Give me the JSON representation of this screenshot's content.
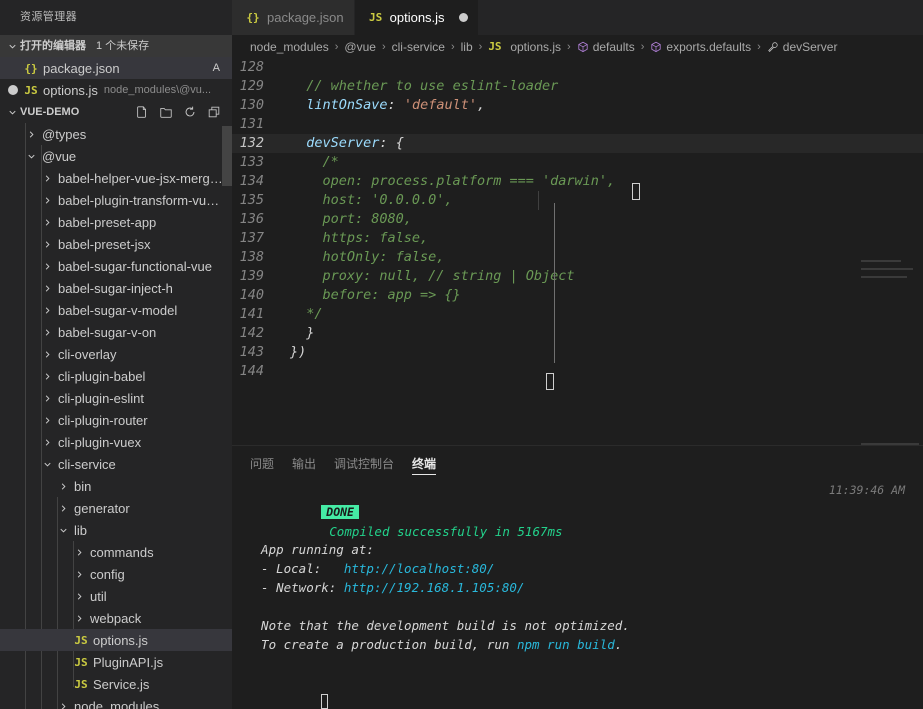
{
  "sidebar": {
    "title": "资源管理器",
    "open_editors": {
      "label": "打开的编辑器",
      "badge": "1 个未保存",
      "items": [
        {
          "icon": "json-file-icon",
          "icon_glyph": "{}",
          "name": "package.json",
          "path": "",
          "flag": "A",
          "dirty": false,
          "selected": true
        },
        {
          "icon": "js-file-icon",
          "icon_glyph": "JS",
          "name": "options.js",
          "path": "node_modules\\@vu...",
          "flag": "",
          "dirty": true,
          "selected": false
        }
      ]
    },
    "project": {
      "label": "VUE-DEMO",
      "actions": [
        "new-file-icon",
        "new-folder-icon",
        "refresh-icon",
        "collapse-all-icon"
      ],
      "tree": [
        {
          "label": "@types",
          "depth": 1,
          "state": "collapsed",
          "type": "folder"
        },
        {
          "label": "@vue",
          "depth": 1,
          "state": "expanded",
          "type": "folder"
        },
        {
          "label": "babel-helper-vue-jsx-merge-...",
          "depth": 2,
          "state": "collapsed",
          "type": "folder"
        },
        {
          "label": "babel-plugin-transform-vue-jsx",
          "depth": 2,
          "state": "collapsed",
          "type": "folder"
        },
        {
          "label": "babel-preset-app",
          "depth": 2,
          "state": "collapsed",
          "type": "folder"
        },
        {
          "label": "babel-preset-jsx",
          "depth": 2,
          "state": "collapsed",
          "type": "folder"
        },
        {
          "label": "babel-sugar-functional-vue",
          "depth": 2,
          "state": "collapsed",
          "type": "folder"
        },
        {
          "label": "babel-sugar-inject-h",
          "depth": 2,
          "state": "collapsed",
          "type": "folder"
        },
        {
          "label": "babel-sugar-v-model",
          "depth": 2,
          "state": "collapsed",
          "type": "folder"
        },
        {
          "label": "babel-sugar-v-on",
          "depth": 2,
          "state": "collapsed",
          "type": "folder"
        },
        {
          "label": "cli-overlay",
          "depth": 2,
          "state": "collapsed",
          "type": "folder"
        },
        {
          "label": "cli-plugin-babel",
          "depth": 2,
          "state": "collapsed",
          "type": "folder"
        },
        {
          "label": "cli-plugin-eslint",
          "depth": 2,
          "state": "collapsed",
          "type": "folder"
        },
        {
          "label": "cli-plugin-router",
          "depth": 2,
          "state": "collapsed",
          "type": "folder"
        },
        {
          "label": "cli-plugin-vuex",
          "depth": 2,
          "state": "collapsed",
          "type": "folder"
        },
        {
          "label": "cli-service",
          "depth": 2,
          "state": "expanded",
          "type": "folder"
        },
        {
          "label": "bin",
          "depth": 3,
          "state": "collapsed",
          "type": "folder"
        },
        {
          "label": "generator",
          "depth": 3,
          "state": "collapsed",
          "type": "folder"
        },
        {
          "label": "lib",
          "depth": 3,
          "state": "expanded",
          "type": "folder"
        },
        {
          "label": "commands",
          "depth": 4,
          "state": "collapsed",
          "type": "folder"
        },
        {
          "label": "config",
          "depth": 4,
          "state": "collapsed",
          "type": "folder"
        },
        {
          "label": "util",
          "depth": 4,
          "state": "collapsed",
          "type": "folder"
        },
        {
          "label": "webpack",
          "depth": 4,
          "state": "collapsed",
          "type": "folder"
        },
        {
          "label": "options.js",
          "depth": 4,
          "state": "file",
          "type": "js",
          "icon_glyph": "JS",
          "selected": true
        },
        {
          "label": "PluginAPI.js",
          "depth": 4,
          "state": "file",
          "type": "js",
          "icon_glyph": "JS"
        },
        {
          "label": "Service.js",
          "depth": 4,
          "state": "file",
          "type": "js",
          "icon_glyph": "JS"
        },
        {
          "label": "node_modules",
          "depth": 3,
          "state": "collapsed",
          "type": "folder"
        }
      ]
    }
  },
  "tabs": [
    {
      "name": "package.json",
      "icon": "json-file-icon",
      "icon_glyph": "{}",
      "active": false,
      "dirty": false
    },
    {
      "name": "options.js",
      "icon": "js-file-icon",
      "icon_glyph": "JS",
      "active": true,
      "dirty": true
    }
  ],
  "breadcrumb": [
    {
      "label": "node_modules",
      "icon": ""
    },
    {
      "label": "@vue",
      "icon": ""
    },
    {
      "label": "cli-service",
      "icon": ""
    },
    {
      "label": "lib",
      "icon": ""
    },
    {
      "label": "options.js",
      "icon": "js-file-icon",
      "icon_glyph": "JS"
    },
    {
      "label": "defaults",
      "icon": "symbol-object-icon"
    },
    {
      "label": "exports.defaults",
      "icon": "symbol-object-icon"
    },
    {
      "label": "devServer",
      "icon": "symbol-property-icon"
    }
  ],
  "editor": {
    "first_line": 128,
    "current_line": 132,
    "lines": [
      {
        "n": 128,
        "tokens": []
      },
      {
        "n": 129,
        "tokens": [
          {
            "t": "  ",
            "c": "pun"
          },
          {
            "t": "// whether to use eslint-loader",
            "c": "com"
          }
        ]
      },
      {
        "n": 130,
        "tokens": [
          {
            "t": "  ",
            "c": "pun"
          },
          {
            "t": "lintOnSave",
            "c": "key"
          },
          {
            "t": ": ",
            "c": "pun"
          },
          {
            "t": "'default'",
            "c": "str"
          },
          {
            "t": ",",
            "c": "pun"
          }
        ]
      },
      {
        "n": 131,
        "tokens": []
      },
      {
        "n": 132,
        "tokens": [
          {
            "t": "  ",
            "c": "pun"
          },
          {
            "t": "devServer",
            "c": "key"
          },
          {
            "t": ": ",
            "c": "pun"
          },
          {
            "t": "{",
            "c": "def"
          }
        ]
      },
      {
        "n": 133,
        "tokens": [
          {
            "t": "    ",
            "c": "pun"
          },
          {
            "t": "/*",
            "c": "com"
          }
        ]
      },
      {
        "n": 134,
        "tokens": [
          {
            "t": "    ",
            "c": "pun"
          },
          {
            "t": "open: process.platform === 'darwin',",
            "c": "com"
          }
        ]
      },
      {
        "n": 135,
        "tokens": [
          {
            "t": "    ",
            "c": "pun"
          },
          {
            "t": "host: '0.0.0.0',",
            "c": "com"
          }
        ]
      },
      {
        "n": 136,
        "tokens": [
          {
            "t": "    ",
            "c": "pun"
          },
          {
            "t": "port: 8080,",
            "c": "com"
          }
        ]
      },
      {
        "n": 137,
        "tokens": [
          {
            "t": "    ",
            "c": "pun"
          },
          {
            "t": "https: false,",
            "c": "com"
          }
        ]
      },
      {
        "n": 138,
        "tokens": [
          {
            "t": "    ",
            "c": "pun"
          },
          {
            "t": "hotOnly: false,",
            "c": "com"
          }
        ]
      },
      {
        "n": 139,
        "tokens": [
          {
            "t": "    ",
            "c": "pun"
          },
          {
            "t": "proxy: null, // string | Object",
            "c": "com"
          }
        ]
      },
      {
        "n": 140,
        "tokens": [
          {
            "t": "    ",
            "c": "pun"
          },
          {
            "t": "before: app => {}",
            "c": "com"
          }
        ]
      },
      {
        "n": 141,
        "tokens": [
          {
            "t": "  ",
            "c": "pun"
          },
          {
            "t": "*/",
            "c": "com"
          }
        ]
      },
      {
        "n": 142,
        "tokens": [
          {
            "t": "  ",
            "c": "pun"
          },
          {
            "t": "}",
            "c": "def"
          }
        ]
      },
      {
        "n": 143,
        "tokens": [
          {
            "t": "})",
            "c": "def"
          }
        ]
      },
      {
        "n": 144,
        "tokens": []
      }
    ]
  },
  "panel": {
    "tabs": [
      {
        "label": "问题",
        "active": false
      },
      {
        "label": "输出",
        "active": false
      },
      {
        "label": "调试控制台",
        "active": false
      },
      {
        "label": "终端",
        "active": true
      }
    ],
    "terminal": {
      "status_badge": "DONE",
      "status_message": "Compiled successfully in 5167ms",
      "timestamp": "11:39:46 AM",
      "lines": [
        {
          "segs": [
            {
              "t": "  App running at:",
              "c": "white"
            }
          ]
        },
        {
          "segs": [
            {
              "t": "  - Local:   ",
              "c": "white"
            },
            {
              "t": "http://localhost:80/",
              "c": "cyan"
            }
          ]
        },
        {
          "segs": [
            {
              "t": "  - Network: ",
              "c": "white"
            },
            {
              "t": "http://192.168.1.105:80/",
              "c": "cyan"
            }
          ]
        },
        {
          "segs": []
        },
        {
          "segs": [
            {
              "t": "  Note that the development build is not optimized.",
              "c": "white"
            }
          ]
        },
        {
          "segs": [
            {
              "t": "  To create a production build, run ",
              "c": "white"
            },
            {
              "t": "npm run build",
              "c": "cyan"
            },
            {
              "t": ".",
              "c": "white"
            }
          ]
        }
      ]
    }
  },
  "colors": {
    "editor_bg": "#1e1e1e",
    "sidebar_bg": "#252526",
    "tab_inactive_bg": "#2d2d2d",
    "selection_bg": "#37373d",
    "comment_green": "#6A9955",
    "keyword_blue": "#9CDCFE",
    "string_orange": "#CE9178",
    "terminal_cyan": "#29b8db",
    "badge_green": "#45eba5"
  }
}
